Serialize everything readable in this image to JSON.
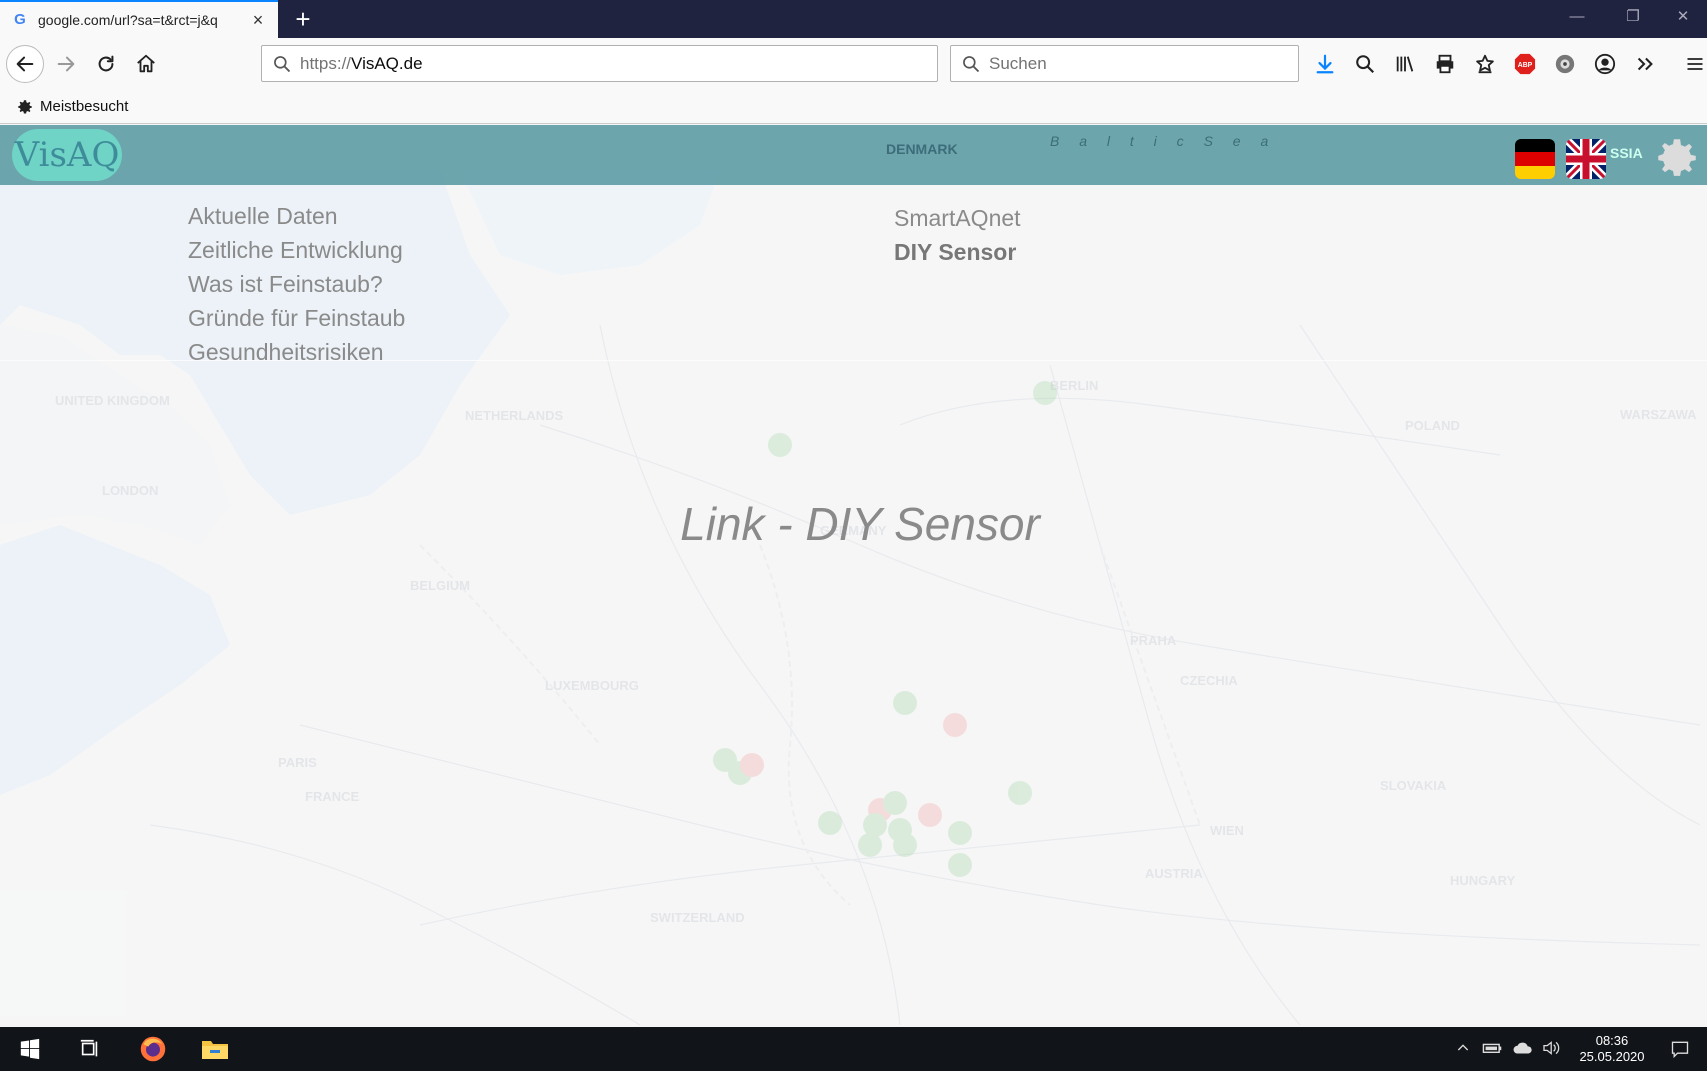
{
  "browser": {
    "tab": {
      "title": "google.com/url?sa=t&rct=j&q",
      "favicon": "google-favicon",
      "close": "×"
    },
    "new_tab": "+",
    "window_controls": {
      "minimize": "—",
      "maximize": "❐",
      "close": "✕"
    },
    "url": {
      "protocol": "https://",
      "host": "VisAQ.de"
    },
    "search": {
      "placeholder": "Suchen"
    },
    "toolbar_icons": [
      "download-icon",
      "search-icon",
      "library-icon",
      "print-icon",
      "bookmark-star-icon",
      "adblock-icon",
      "extension-icon",
      "account-icon",
      "overflow-icon",
      "menu-icon"
    ],
    "adblock_label": "ABP",
    "bookmarks": [
      {
        "label": "Meistbesucht",
        "icon": "gear-icon"
      }
    ]
  },
  "page": {
    "logo": "VisAQ",
    "map_labels": {
      "denmark": "DENMARK",
      "russia": "SSIA",
      "baltic": "B a l t i c   S e a"
    },
    "nav_left": [
      "Aktuelle Daten",
      "Zeitliche Entwicklung",
      "Was ist Feinstaub?",
      "Gründe für Feinstaub",
      "Gesundheitsrisiken"
    ],
    "nav_right": [
      "SmartAQnet",
      "DIY Sensor"
    ],
    "active_nav": "DIY Sensor",
    "heading": "Link - DIY Sensor",
    "languages": [
      "de-flag-icon",
      "uk-flag-icon"
    ]
  },
  "taskbar": {
    "icons": [
      "windows-start-icon",
      "task-view-icon",
      "firefox-icon",
      "file-explorer-icon"
    ],
    "tray": [
      "chevron-up-icon",
      "battery-icon",
      "onedrive-icon",
      "volume-icon"
    ],
    "time": "08:36",
    "date": "25.05.2020"
  },
  "colors": {
    "header": "#5596a0",
    "accent": "#0a84ff",
    "titlebar": "#202340"
  }
}
